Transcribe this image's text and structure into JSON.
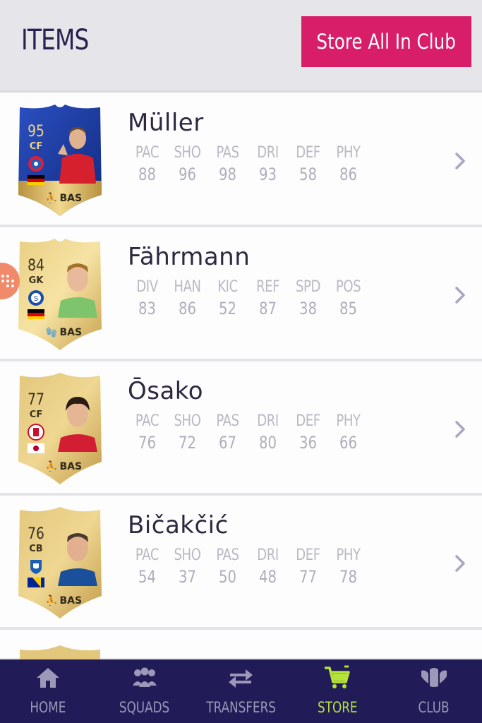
{
  "header": {
    "title": "ITEMS",
    "store_button_label": "Store All In Club"
  },
  "items": [
    {
      "name": "Müller",
      "rating": "95",
      "position": "CF",
      "chemistry_style": "BAS",
      "card_style": "tots",
      "stat_labels": [
        "PAC",
        "SHO",
        "PAS",
        "DRI",
        "DEF",
        "PHY"
      ],
      "stat_values": [
        "88",
        "96",
        "98",
        "93",
        "58",
        "86"
      ]
    },
    {
      "name": "Fährmann",
      "rating": "84",
      "position": "GK",
      "chemistry_style": "BAS",
      "card_style": "gold",
      "stat_labels": [
        "DIV",
        "HAN",
        "KIC",
        "REF",
        "SPD",
        "POS"
      ],
      "stat_values": [
        "83",
        "86",
        "52",
        "87",
        "38",
        "85"
      ]
    },
    {
      "name": "Ōsako",
      "rating": "77",
      "position": "CF",
      "chemistry_style": "BAS",
      "card_style": "gold",
      "stat_labels": [
        "PAC",
        "SHO",
        "PAS",
        "DRI",
        "DEF",
        "PHY"
      ],
      "stat_values": [
        "76",
        "72",
        "67",
        "80",
        "36",
        "66"
      ]
    },
    {
      "name": "Bičakčić",
      "rating": "76",
      "position": "CB",
      "chemistry_style": "BAS",
      "card_style": "gold",
      "stat_labels": [
        "PAC",
        "SHO",
        "PAS",
        "DRI",
        "DEF",
        "PHY"
      ],
      "stat_values": [
        "54",
        "37",
        "50",
        "48",
        "77",
        "78"
      ]
    }
  ],
  "tabs": [
    {
      "label": "HOME",
      "icon": "home-icon",
      "active": false
    },
    {
      "label": "SQUADS",
      "icon": "squads-icon",
      "active": false
    },
    {
      "label": "TRANSFERS",
      "icon": "transfers-icon",
      "active": false
    },
    {
      "label": "STORE",
      "icon": "cart-icon",
      "active": true
    },
    {
      "label": "CLUB",
      "icon": "club-icon",
      "active": false
    }
  ],
  "colors": {
    "accent": "#d81d69",
    "active_tab": "#b4e33a",
    "tabbar_bg": "#211b57",
    "gold": "#d8b868",
    "tots_blue": "#1c3fa8"
  }
}
